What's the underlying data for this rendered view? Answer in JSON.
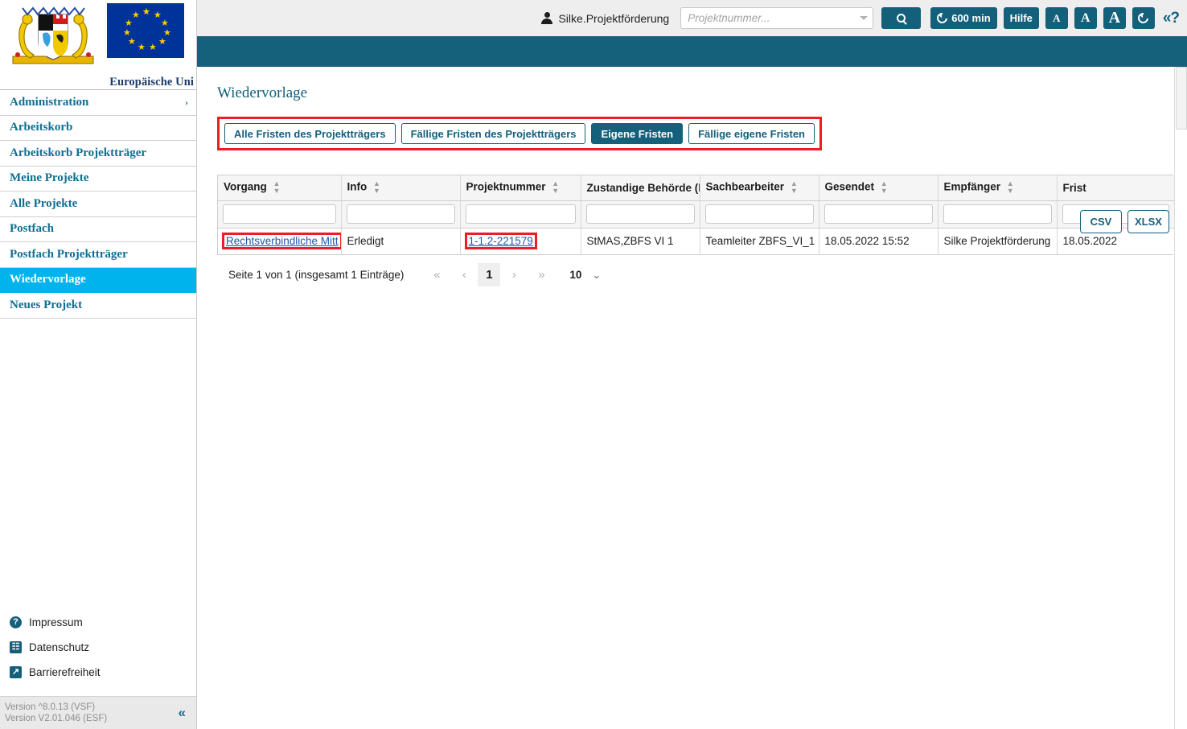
{
  "header": {
    "user_name": "Silke.Projektförderung",
    "user_icon": "user-icon",
    "search_placeholder": "Projektnummer...",
    "search_value": "",
    "search_icon": "search-icon",
    "session_timer": "600 min",
    "session_icon": "refresh-icon",
    "help_label": "Hilfe",
    "font_small": "A",
    "font_medium": "A",
    "font_large": "A",
    "reload_icon": "refresh-icon",
    "help_question": "«?",
    "accent_teal": "#15607a"
  },
  "sidebar": {
    "eu_caption": "Europäische Uni",
    "crest_icon": "bavaria-coat-of-arms-icon",
    "eu_flag_icon": "eu-flag-icon",
    "items": [
      {
        "label": "Administration",
        "has_chevron": true,
        "active": false,
        "chevron": "›"
      },
      {
        "label": "Arbeitskorb",
        "has_chevron": false,
        "active": false
      },
      {
        "label": "Arbeitskorb Projektträger",
        "has_chevron": false,
        "active": false
      },
      {
        "label": "Meine Projekte",
        "has_chevron": false,
        "active": false
      },
      {
        "label": "Alle Projekte",
        "has_chevron": false,
        "active": false
      },
      {
        "label": "Postfach",
        "has_chevron": false,
        "active": false
      },
      {
        "label": "Postfach Projektträger",
        "has_chevron": false,
        "active": false
      },
      {
        "label": "Wiedervorlage",
        "has_chevron": false,
        "active": true
      },
      {
        "label": "Neues Projekt",
        "has_chevron": false,
        "active": false
      }
    ],
    "footer_links": [
      {
        "label": "Impressum",
        "icon": "question-circle-icon",
        "glyph": "?"
      },
      {
        "label": "Datenschutz",
        "icon": "document-person-icon",
        "glyph": "☷"
      },
      {
        "label": "Barrierefreiheit",
        "icon": "external-link-icon",
        "glyph": "↗"
      }
    ],
    "version_line1": "Version ^8.0.13 (VSF)",
    "version_line2": "Version V2.01.046 (ESF)",
    "collapse_icon": "collapse-chevron-icon",
    "collapse_glyph": "«",
    "active_color": "#00b3ed"
  },
  "main": {
    "page_title": "Wiedervorlage",
    "tabs": [
      {
        "label": "Alle Fristen des Projektträgers",
        "selected": false
      },
      {
        "label": "Fällige Fristen des Projektträgers",
        "selected": false
      },
      {
        "label": "Eigene Fristen",
        "selected": true
      },
      {
        "label": "Fällige eigene Fristen",
        "selected": false
      }
    ],
    "highlight_color": "#ee1c24",
    "export": [
      {
        "label": "CSV"
      },
      {
        "label": "XLSX"
      }
    ],
    "table": {
      "columns": [
        {
          "label": "Vorgang",
          "sortable": true
        },
        {
          "label": "Info",
          "sortable": true
        },
        {
          "label": "Projektnummer",
          "sortable": true
        },
        {
          "label": "Zustandige Behörde (F",
          "sortable": false
        },
        {
          "label": "Sachbearbeiter",
          "sortable": true
        },
        {
          "label": "Gesendet",
          "sortable": true
        },
        {
          "label": "Empfänger",
          "sortable": true
        },
        {
          "label": "Frist",
          "sortable": false
        }
      ],
      "filters": [
        "",
        "",
        "",
        "",
        "",
        "",
        "",
        ""
      ],
      "rows": [
        {
          "vorgang": "Rechtsverbindliche Mitt",
          "info": "Erledigt",
          "projektnummer": "1-1.2-221579",
          "behoerde": "StMAS,ZBFS VI 1",
          "sachbearbeiter": "Teamleiter ZBFS_VI_1",
          "gesendet": "18.05.2022 15:52",
          "empfaenger": "Silke Projektförderung",
          "frist": "18.05.2022"
        }
      ]
    },
    "pagination": {
      "info": "Seite 1 von 1 (insgesamt 1 Einträge)",
      "first": "«",
      "prev": "‹",
      "current_page": "1",
      "next": "›",
      "last": "»",
      "page_size": "10",
      "page_size_caret": "⌄"
    }
  }
}
